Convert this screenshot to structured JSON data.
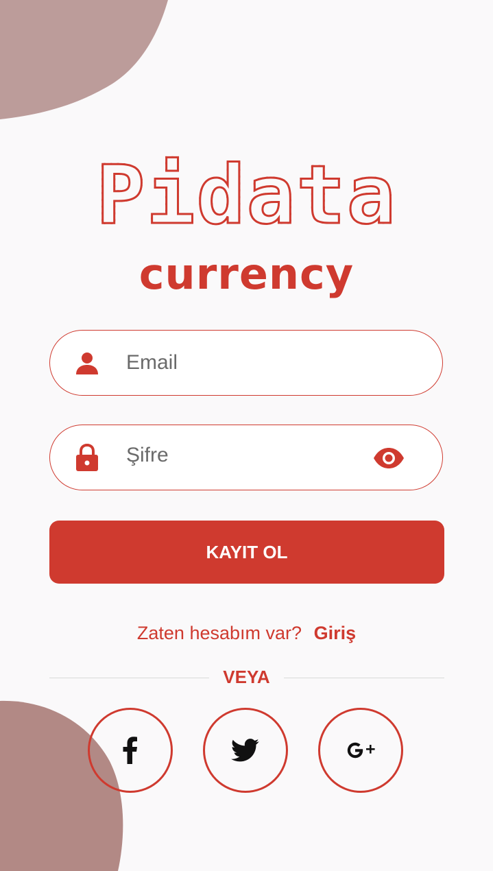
{
  "colors": {
    "accent": "#cf3a2f",
    "background": "#faf9fa",
    "blob": "#b58c89"
  },
  "logo": {
    "title": "Pidata",
    "subtitle": "currency"
  },
  "form": {
    "email": {
      "placeholder": "Email",
      "icon": "user-icon"
    },
    "password": {
      "placeholder": "Şifre",
      "icon": "lock-icon",
      "toggle_icon": "eye-icon"
    },
    "submit_label": "KAYIT OL"
  },
  "login": {
    "prompt": "Zaten hesabım var?",
    "link": "Giriş"
  },
  "divider_label": "VEYA",
  "social": [
    {
      "name": "facebook",
      "icon": "facebook-icon"
    },
    {
      "name": "twitter",
      "icon": "twitter-icon"
    },
    {
      "name": "google-plus",
      "icon": "google-plus-icon"
    }
  ]
}
